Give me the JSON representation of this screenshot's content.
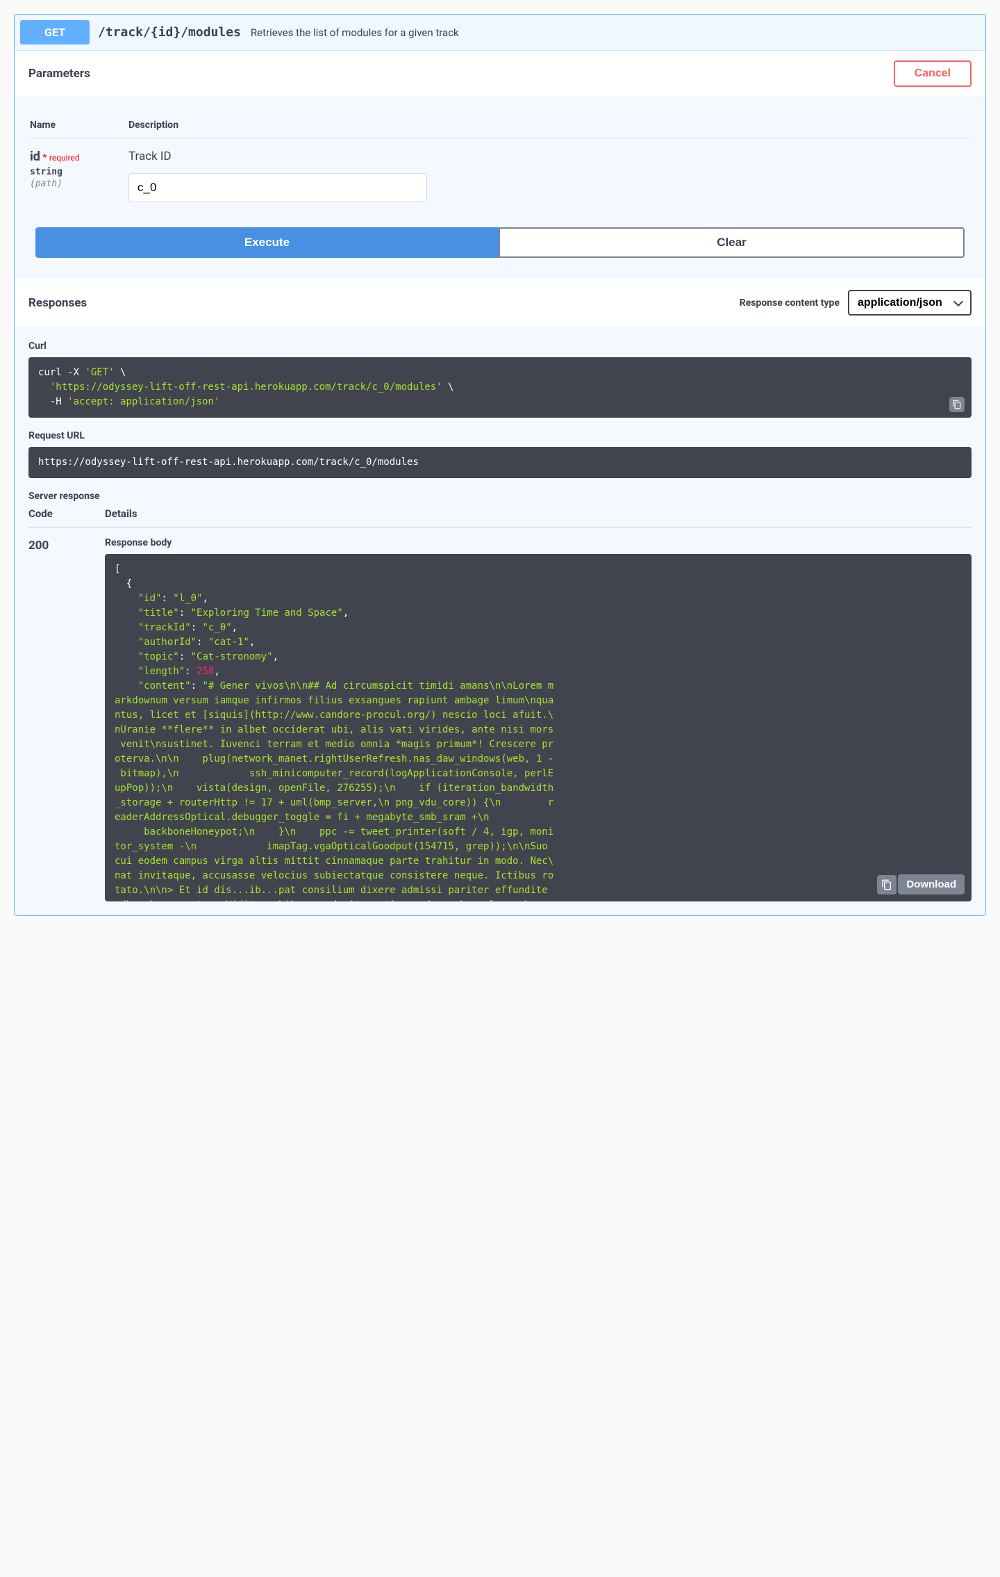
{
  "summary": {
    "method": "GET",
    "path": "/track/{id}/modules",
    "description": "Retrieves the list of modules for a given track"
  },
  "parameters": {
    "heading": "Parameters",
    "cancel_label": "Cancel",
    "columns": {
      "name": "Name",
      "description": "Description"
    },
    "items": [
      {
        "name": "id",
        "required_label": "required",
        "type": "string",
        "in": "(path)",
        "description": "Track ID",
        "value": "c_0"
      }
    ],
    "execute_label": "Execute",
    "clear_label": "Clear"
  },
  "responses": {
    "heading": "Responses",
    "content_type_label": "Response content type",
    "content_type_value": "application/json",
    "curl_label": "Curl",
    "curl_text": "curl -X 'GET' \\\n  'https://odyssey-lift-off-rest-api.herokuapp.com/track/c_0/modules' \\\n  -H 'accept: application/json'",
    "request_url_label": "Request URL",
    "request_url": "https://odyssey-lift-off-rest-api.herokuapp.com/track/c_0/modules",
    "server_response_label": "Server response",
    "columns": {
      "code": "Code",
      "details": "Details"
    },
    "status_code": "200",
    "response_body_label": "Response body",
    "download_label": "Download",
    "body_items": [
      {
        "id": "l_0",
        "title": "Exploring Time and Space",
        "trackId": "c_0",
        "authorId": "cat-1",
        "topic": "Cat-stronomy",
        "length": 258,
        "content": "# Gener vivos\\n\\n## Ad circumspicit timidi amans\\n\\nLorem markdownum versum iamque infirmos filius exsangues rapiunt ambage limum\\nquantus, licet et [siquis](http://www.candore-procul.org/) nescio loci afuit.\\nUranie **flere** in albet occiderat ubi, alis vati virides, ante nisi mors venit\\nsustinet. Iuvenci terram et medio omnia *magis primum*! Crescere proterva.\\n\\n    plug(network_manet.rightUserRefresh.nas_daw_windows(web, 1 - bitmap),\\n            ssh_minicomputer_record(logApplicationConsole, perlEupPop));\\n    vista(design, openFile, 276255);\\n    if (iteration_bandwidth_storage + routerHttp != 17 + uml(bmp_server,\\n png_vdu_core)) {\\n        readerAddressOptical.debugger_toggle = fi + megabyte_smb_sram +\\n                backboneHoneypot;\\n    }\\n    ppc -= tweet_printer(soft / 4, igp, monitor_system -\\n            imapTag.vgaOpticalGoodput(154715, grep));\\n\\nSuo cui eodem campus virga altis mittit cinnamaque parte trahitur in modo. Nec\\nat invitaque, accusasse velocius subiectatque consistere neque. Ictibus rotato.\\n\\n> Et id dis...ib...pat consilium dixere admissi pariter effundite ad\\n> hosp...ot... Vidit prohibes producit, antiquus deum; hoc clamore\\n> membrana annosa"
      }
    ]
  }
}
